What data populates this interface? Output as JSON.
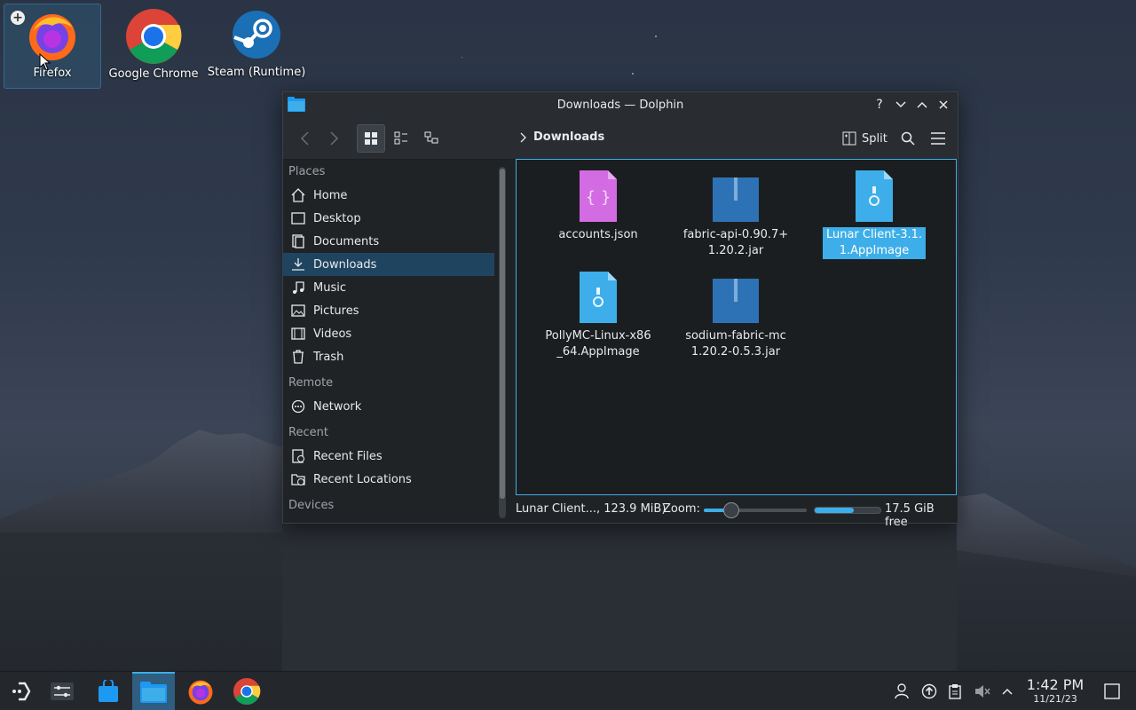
{
  "desktop": {
    "icons": [
      {
        "label": "Firefox"
      },
      {
        "label": "Google Chrome"
      },
      {
        "label": "Steam (Runtime)"
      }
    ]
  },
  "window": {
    "title": "Downloads — Dolphin",
    "breadcrumb": "Downloads",
    "split_label": "Split",
    "sidebar": {
      "sections": [
        {
          "label": "Places"
        },
        {
          "label": "Remote"
        },
        {
          "label": "Recent"
        },
        {
          "label": "Devices"
        }
      ],
      "places": [
        "Home",
        "Desktop",
        "Documents",
        "Downloads",
        "Music",
        "Pictures",
        "Videos",
        "Trash"
      ],
      "remote": [
        "Network"
      ],
      "recent": [
        "Recent Files",
        "Recent Locations"
      ],
      "active_item": "Downloads"
    },
    "files": [
      {
        "name": "accounts.json",
        "type": "json"
      },
      {
        "name": "fabric-api-0.90.7+1.20.2.jar",
        "type": "archive"
      },
      {
        "name": "Lunar Client-3.1.1.AppImage",
        "type": "appimage",
        "selected": true
      },
      {
        "name": "PollyMC-Linux-x86_64.AppImage",
        "type": "appimage"
      },
      {
        "name": "sodium-fabric-mc1.20.2-0.5.3.jar",
        "type": "archive"
      }
    ],
    "status": {
      "selection_info": "Lunar Client..., 123.9 MiB)",
      "zoom_label": "Zoom:",
      "free_space": "17.5 GiB free",
      "disk_used_fraction": 0.6
    }
  },
  "taskbar": {
    "clock_time": "1:42 PM",
    "clock_date": "11/21/23",
    "accent": "#3daee9"
  }
}
